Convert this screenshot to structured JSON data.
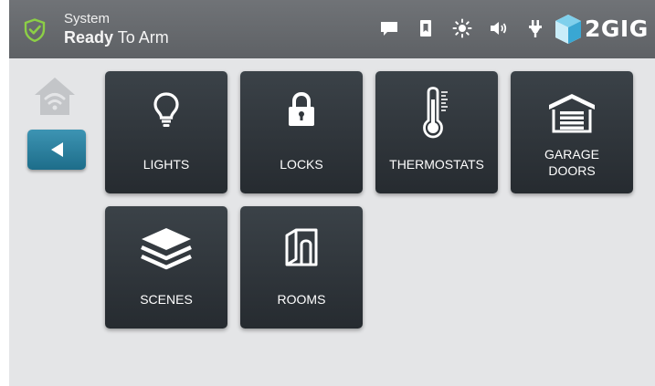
{
  "status": {
    "line1": "System",
    "line2_bold": "Ready",
    "line2_rest": " To Arm",
    "shield_color": "#8ccf46"
  },
  "header_icons": [
    "message-icon",
    "bookmark-icon",
    "brightness-icon",
    "volume-icon",
    "power-plug-icon"
  ],
  "logo": {
    "text": "2GIG"
  },
  "tiles": [
    {
      "label": "LIGHTS",
      "icon": "lightbulb-icon"
    },
    {
      "label": "LOCKS",
      "icon": "padlock-icon"
    },
    {
      "label": "THERMOSTATS",
      "icon": "thermometer-icon"
    },
    {
      "label": "GARAGE\nDOORS",
      "icon": "garage-icon"
    },
    {
      "label": "SCENES",
      "icon": "layers-icon"
    },
    {
      "label": "ROOMS",
      "icon": "room-icon"
    }
  ],
  "colors": {
    "topbar": "#65686c",
    "background": "#e4e5e7",
    "tile": "#30363b",
    "back_button": "#2a81a0"
  }
}
